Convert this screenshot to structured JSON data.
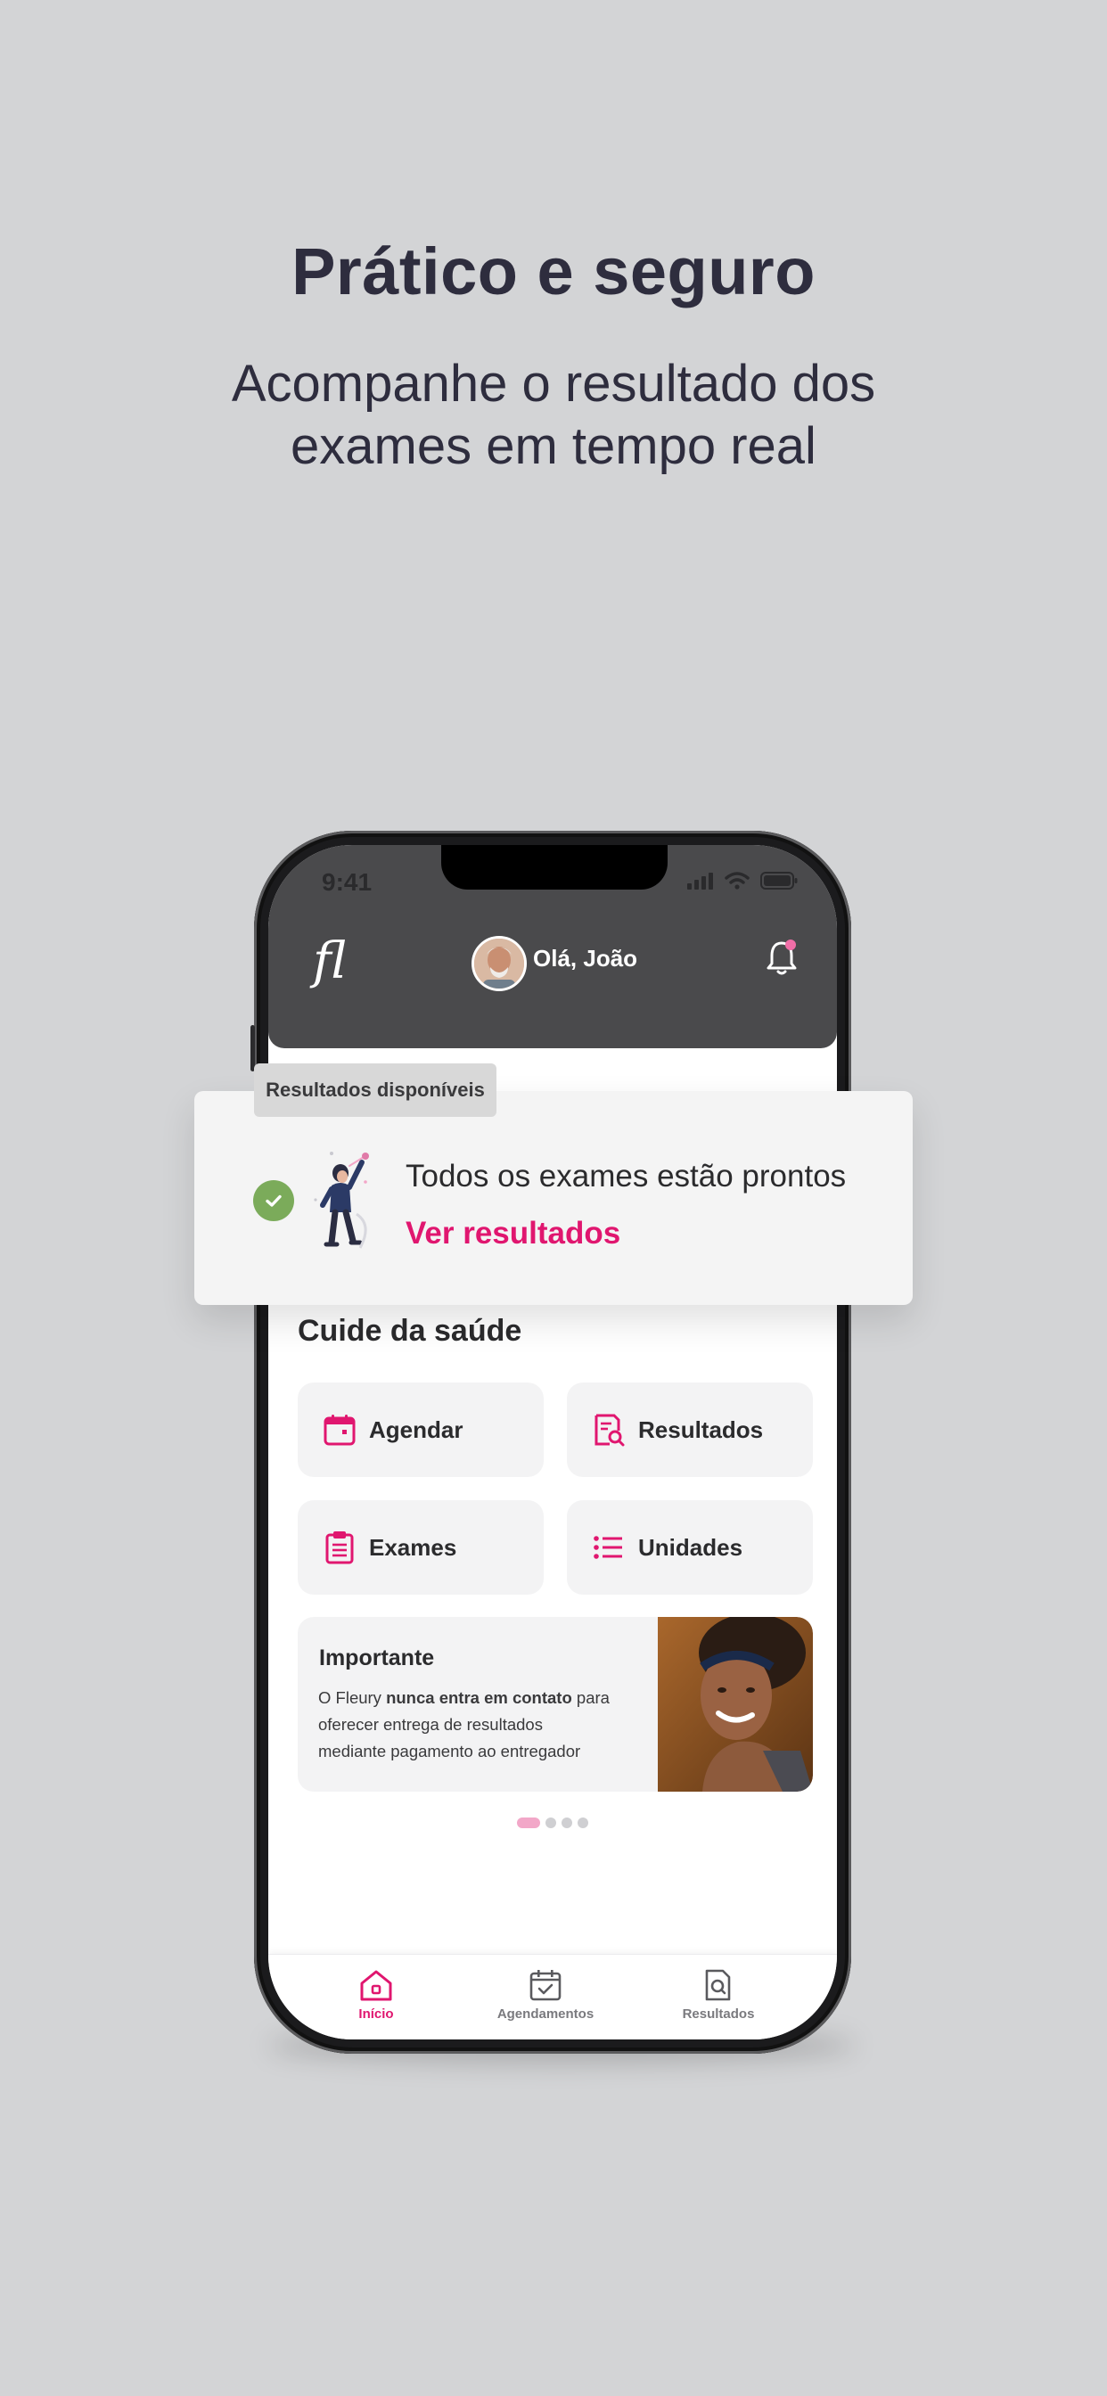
{
  "hero": {
    "title": "Prático e seguro",
    "subtitle_line1": "Acompanhe o resultado dos",
    "subtitle_line2": "exames em tempo real"
  },
  "status_bar": {
    "time": "9:41"
  },
  "header": {
    "logo": "fl",
    "greeting": "Olá, João",
    "notification_badge_color": "#e0166f"
  },
  "notification_card": {
    "tag": "Resultados disponíveis",
    "message": "Todos os exames estão prontos",
    "link": "Ver resultados"
  },
  "section": {
    "title": "Cuide da saúde"
  },
  "tiles": [
    {
      "label": "Agendar",
      "icon": "calendar-icon"
    },
    {
      "label": "Resultados",
      "icon": "document-search-icon"
    },
    {
      "label": "Exames",
      "icon": "clipboard-icon"
    },
    {
      "label": "Unidades",
      "icon": "list-icon"
    }
  ],
  "banner": {
    "title": "Importante",
    "text_prefix": "O Fleury ",
    "text_bold": "nunca entra em contato",
    "text_rest": " para oferecer entrega de resultados mediante pagamento ao entregador"
  },
  "carousel": {
    "active_index": 0,
    "count": 4
  },
  "tabbar": [
    {
      "label": "Início",
      "icon": "home-icon",
      "active": true
    },
    {
      "label": "Agendamentos",
      "icon": "calendar-check-icon",
      "active": false
    },
    {
      "label": "Resultados",
      "icon": "document-search-icon",
      "active": false
    }
  ],
  "colors": {
    "accent": "#e0166f",
    "success": "#7bab5a",
    "header_bg": "#4a4a4c",
    "page_bg": "#d3d4d6"
  }
}
